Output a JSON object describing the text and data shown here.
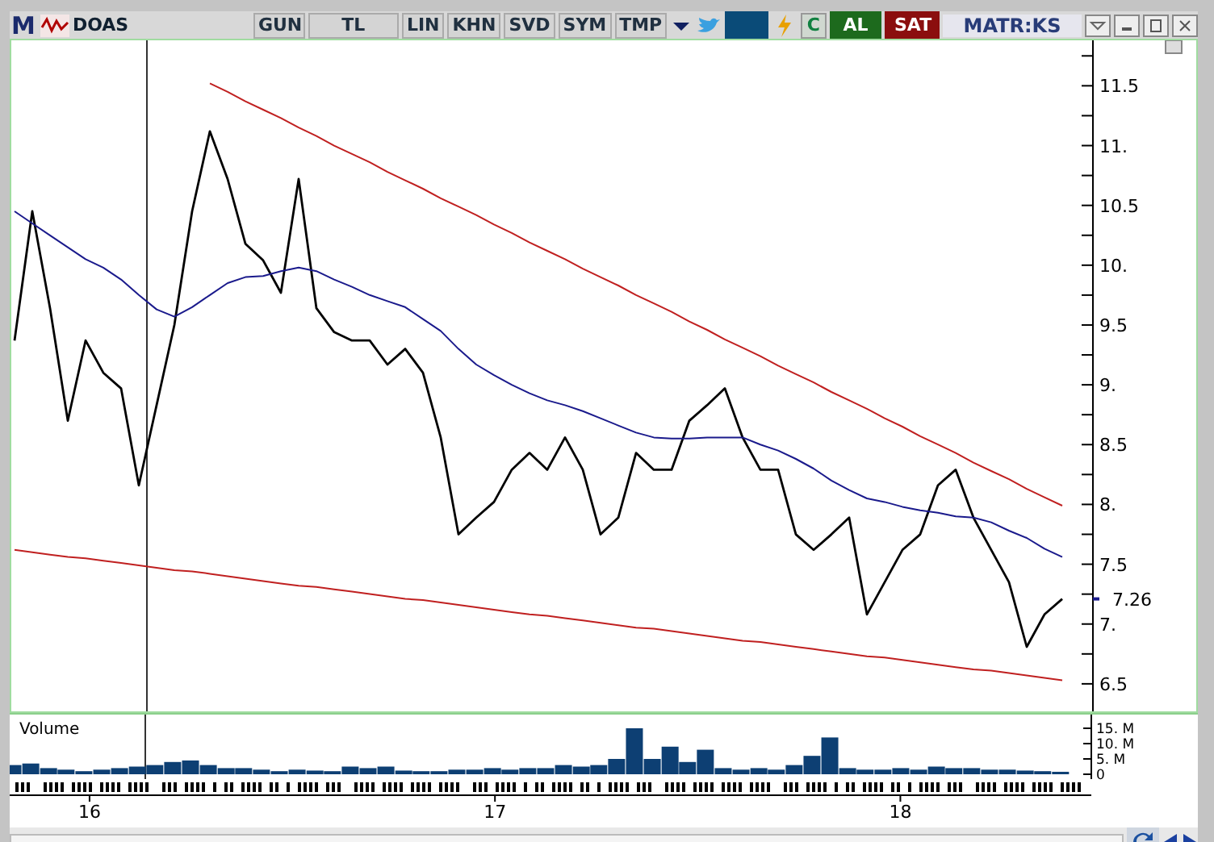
{
  "toolbar": {
    "logo": "M",
    "symbol": "DOAS",
    "buttons": [
      "GUN",
      "TL",
      "LIN",
      "KHN",
      "SVD",
      "SYM",
      "TMP"
    ],
    "refresh": "C",
    "buy": "AL",
    "sell": "SAT",
    "brand": "MATR:KS"
  },
  "price_chart": {
    "last_value_label": "7.26",
    "chart_data": {
      "type": "line",
      "series": [
        {
          "color": "#000000",
          "values": [
            9.37,
            10.45,
            9.64,
            8.7,
            9.37,
            9.1,
            8.97,
            8.16,
            8.83,
            9.5,
            10.45,
            11.12,
            10.72,
            10.18,
            10.04,
            9.77,
            10.72,
            9.64,
            9.44,
            9.37,
            9.37,
            9.17,
            9.3,
            9.1,
            8.56,
            7.75,
            7.89,
            8.02,
            8.29,
            8.43,
            8.29,
            8.56,
            8.29,
            7.75,
            7.89,
            8.43,
            8.29,
            8.29,
            8.7,
            8.83,
            8.97,
            8.56,
            8.29,
            8.29,
            7.75,
            7.62,
            7.75,
            7.89,
            7.08,
            7.35,
            7.62,
            7.75,
            8.16,
            8.29,
            7.89,
            7.62,
            7.35,
            6.81,
            7.08,
            7.21
          ]
        },
        {
          "color": "#1a1a8c",
          "values": [
            10.45,
            10.35,
            10.25,
            10.15,
            10.05,
            9.98,
            9.88,
            9.75,
            9.63,
            9.57,
            9.65,
            9.75,
            9.85,
            9.9,
            9.91,
            9.95,
            9.98,
            9.95,
            9.88,
            9.82,
            9.75,
            9.7,
            9.65,
            9.55,
            9.45,
            9.3,
            9.17,
            9.08,
            9.0,
            8.93,
            8.87,
            8.83,
            8.78,
            8.72,
            8.66,
            8.6,
            8.56,
            8.55,
            8.55,
            8.56,
            8.56,
            8.56,
            8.5,
            8.45,
            8.38,
            8.3,
            8.2,
            8.12,
            8.05,
            8.02,
            7.98,
            7.95,
            7.93,
            7.9,
            7.89,
            7.85,
            7.78,
            7.72,
            7.63,
            7.56
          ]
        },
        {
          "color": "#c02020",
          "values": [
            null,
            null,
            null,
            null,
            null,
            null,
            null,
            null,
            null,
            null,
            null,
            11.52,
            11.45,
            11.37,
            11.3,
            11.23,
            11.15,
            11.08,
            11.0,
            10.93,
            10.86,
            10.78,
            10.71,
            10.64,
            10.56,
            10.49,
            10.42,
            10.34,
            10.27,
            10.19,
            10.12,
            10.05,
            9.97,
            9.9,
            9.83,
            9.75,
            9.68,
            9.61,
            9.53,
            9.46,
            9.38,
            9.31,
            9.24,
            9.16,
            9.09,
            9.02,
            8.94,
            8.87,
            8.8,
            8.72,
            8.65,
            8.57,
            8.5,
            8.43,
            8.35,
            8.28,
            8.21,
            8.13,
            8.06,
            7.99
          ]
        },
        {
          "color": "#c02020",
          "values": [
            7.62,
            7.6,
            7.58,
            7.56,
            7.55,
            7.53,
            7.51,
            7.49,
            7.47,
            7.45,
            7.44,
            7.42,
            7.4,
            7.38,
            7.36,
            7.34,
            7.32,
            7.31,
            7.29,
            7.27,
            7.25,
            7.23,
            7.21,
            7.2,
            7.18,
            7.16,
            7.14,
            7.12,
            7.1,
            7.08,
            7.07,
            7.05,
            7.03,
            7.01,
            6.99,
            6.97,
            6.96,
            6.94,
            6.92,
            6.9,
            6.88,
            6.86,
            6.85,
            6.83,
            6.81,
            6.79,
            6.77,
            6.75,
            6.73,
            6.72,
            6.7,
            6.68,
            6.66,
            6.64,
            6.62,
            6.61,
            6.59,
            6.57,
            6.55,
            6.53
          ]
        }
      ],
      "ylim": [
        6.27,
        11.88
      ],
      "yticks": [
        {
          "value": 6.5,
          "label": "6.5"
        },
        {
          "value": 7,
          "label": "7."
        },
        {
          "value": 7.5,
          "label": "7.5"
        },
        {
          "value": 8,
          "label": "8."
        },
        {
          "value": 8.5,
          "label": "8.5"
        },
        {
          "value": 9,
          "label": "9."
        },
        {
          "value": 9.5,
          "label": "9.5"
        },
        {
          "value": 10,
          "label": "10."
        },
        {
          "value": 10.5,
          "label": "10.5"
        },
        {
          "value": 11,
          "label": "11."
        },
        {
          "value": 11.5,
          "label": "11.5"
        }
      ]
    }
  },
  "volume_chart": {
    "chart_data": {
      "type": "bar",
      "title": "Volume",
      "x": [
        15.811,
        15.855,
        15.899,
        15.942,
        15.986,
        16.03,
        16.074,
        16.118,
        16.161,
        16.205,
        16.249,
        16.293,
        16.337,
        16.38,
        16.424,
        16.468,
        16.512,
        16.556,
        16.599,
        16.643,
        16.687,
        16.731,
        16.775,
        16.818,
        16.862,
        16.906,
        16.95,
        16.994,
        17.037,
        17.081,
        17.125,
        17.169,
        17.213,
        17.256,
        17.3,
        17.344,
        17.388,
        17.432,
        17.475,
        17.519,
        17.563,
        17.607,
        17.651,
        17.694,
        17.738,
        17.782,
        17.826,
        17.87,
        17.913,
        17.957,
        18.001,
        18.045,
        18.089,
        18.132,
        18.176,
        18.22,
        18.264,
        18.308,
        18.351,
        18.395
      ],
      "values": [
        3,
        3.5,
        2,
        1.5,
        1,
        1.5,
        2,
        2.5,
        3,
        4,
        4.5,
        3,
        2,
        2,
        1.5,
        1,
        1.5,
        1.2,
        1,
        2.5,
        2,
        2.5,
        1.2,
        1,
        1,
        1.5,
        1.5,
        2,
        1.5,
        2,
        2,
        3,
        2.5,
        3,
        5,
        15,
        5,
        9,
        4,
        8,
        2,
        1.5,
        2,
        1.5,
        3,
        6,
        12,
        2,
        1.5,
        1.5,
        2,
        1.5,
        2.5,
        2,
        2,
        1.5,
        1.5,
        1.2,
        1,
        0.8
      ],
      "xlim": [
        15.803,
        18.471
      ],
      "ylim": [
        0,
        19.47
      ],
      "xticks": [
        {
          "value": 16,
          "label": "16"
        },
        {
          "value": 17,
          "label": "17"
        },
        {
          "value": 18,
          "label": "18"
        }
      ],
      "yticks": [
        {
          "value": 0,
          "label": "0"
        },
        {
          "value": 5,
          "label": "5. M"
        },
        {
          "value": 10,
          "label": "10. M"
        },
        {
          "value": 15,
          "label": "15. M"
        }
      ]
    }
  }
}
